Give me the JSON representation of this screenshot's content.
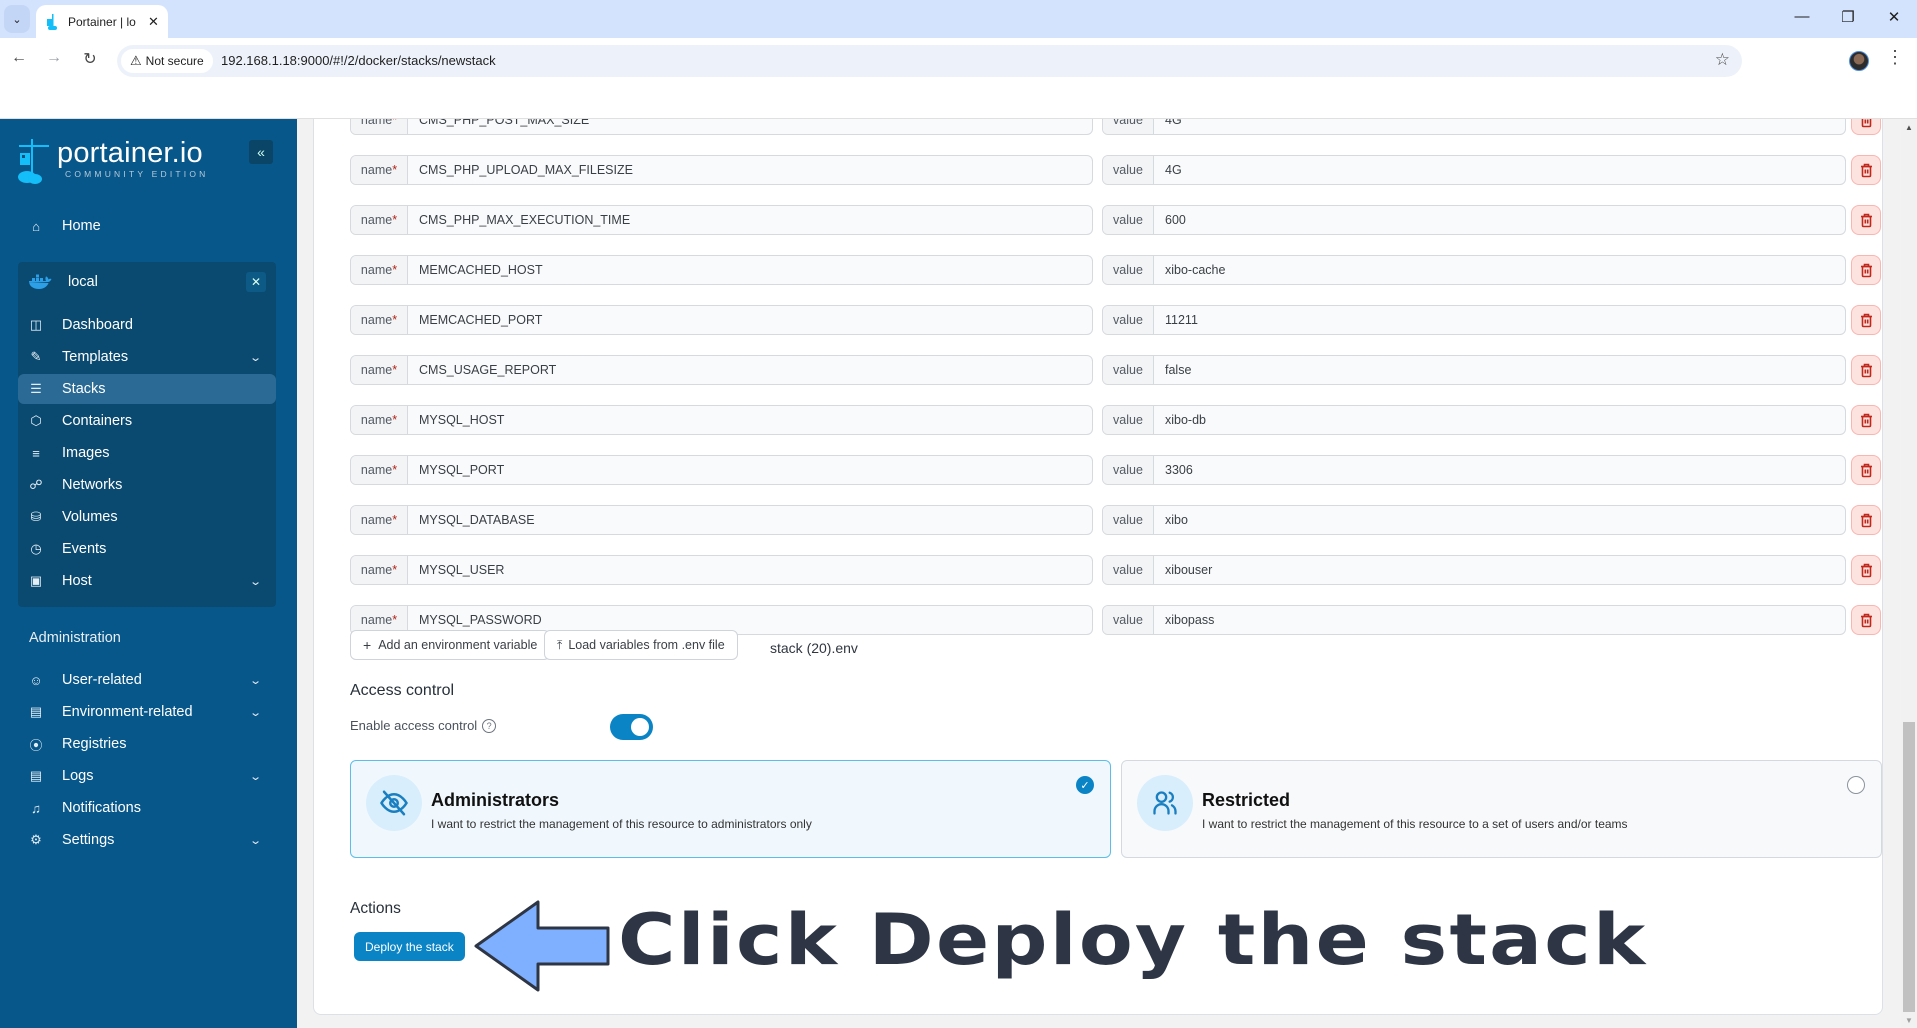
{
  "browser": {
    "tab_title": "Portainer | lo",
    "security_label": "Not secure",
    "url": "192.168.1.18:9000/#!/2/docker/stacks/newstack"
  },
  "sidebar": {
    "logo_main": "portainer.io",
    "logo_sub": "COMMUNITY EDITION",
    "home": "Home",
    "environment": {
      "name": "local",
      "items": [
        {
          "label": "Dashboard",
          "icon": "dashboard-icon",
          "chevron": false
        },
        {
          "label": "Templates",
          "icon": "edit-icon",
          "chevron": true
        },
        {
          "label": "Stacks",
          "icon": "layers-icon",
          "chevron": false,
          "active": true
        },
        {
          "label": "Containers",
          "icon": "box-icon",
          "chevron": false
        },
        {
          "label": "Images",
          "icon": "list-icon",
          "chevron": false
        },
        {
          "label": "Networks",
          "icon": "network-icon",
          "chevron": false
        },
        {
          "label": "Volumes",
          "icon": "database-icon",
          "chevron": false
        },
        {
          "label": "Events",
          "icon": "clock-icon",
          "chevron": false
        },
        {
          "label": "Host",
          "icon": "host-icon",
          "chevron": true
        }
      ]
    },
    "admin_heading": "Administration",
    "admin_items": [
      {
        "label": "User-related",
        "icon": "users-icon",
        "chevron": true
      },
      {
        "label": "Environment-related",
        "icon": "server-icon",
        "chevron": true
      },
      {
        "label": "Registries",
        "icon": "radio-icon",
        "chevron": false
      },
      {
        "label": "Logs",
        "icon": "file-icon",
        "chevron": true
      },
      {
        "label": "Notifications",
        "icon": "bell-icon",
        "chevron": false
      },
      {
        "label": "Settings",
        "icon": "gear-icon",
        "chevron": true
      }
    ]
  },
  "env_vars": {
    "name_label": "name",
    "required_mark": "*",
    "value_label": "value",
    "rows": [
      {
        "name": "CMS_PHP_POST_MAX_SIZE",
        "value": "4G"
      },
      {
        "name": "CMS_PHP_UPLOAD_MAX_FILESIZE",
        "value": "4G"
      },
      {
        "name": "CMS_PHP_MAX_EXECUTION_TIME",
        "value": "600"
      },
      {
        "name": "MEMCACHED_HOST",
        "value": "xibo-cache"
      },
      {
        "name": "MEMCACHED_PORT",
        "value": "11211"
      },
      {
        "name": "CMS_USAGE_REPORT",
        "value": "false"
      },
      {
        "name": "MYSQL_HOST",
        "value": "xibo-db"
      },
      {
        "name": "MYSQL_PORT",
        "value": "3306"
      },
      {
        "name": "MYSQL_DATABASE",
        "value": "xibo"
      },
      {
        "name": "MYSQL_USER",
        "value": "xibouser"
      },
      {
        "name": "MYSQL_PASSWORD",
        "value": "xibopass"
      }
    ],
    "add_button": "Add an environment variable",
    "load_button": "Load variables from .env file",
    "loaded_file": "stack (20).env"
  },
  "access_control": {
    "heading": "Access control",
    "enable_label": "Enable access control",
    "enabled": true,
    "options": [
      {
        "title": "Administrators",
        "description": "I want to restrict the management of this resource to administrators only",
        "selected": true
      },
      {
        "title": "Restricted",
        "description": "I want to restrict the management of this resource to a set of users and/or teams",
        "selected": false
      }
    ]
  },
  "actions": {
    "heading": "Actions",
    "deploy_button": "Deploy the stack"
  },
  "annotation": {
    "text": "Click Deploy the stack",
    "arrow_color": "#7fb0ff"
  },
  "colors": {
    "sidebar_bg": "#07578a",
    "primary": "#0b84c6",
    "danger_bg": "#fde3e0"
  }
}
